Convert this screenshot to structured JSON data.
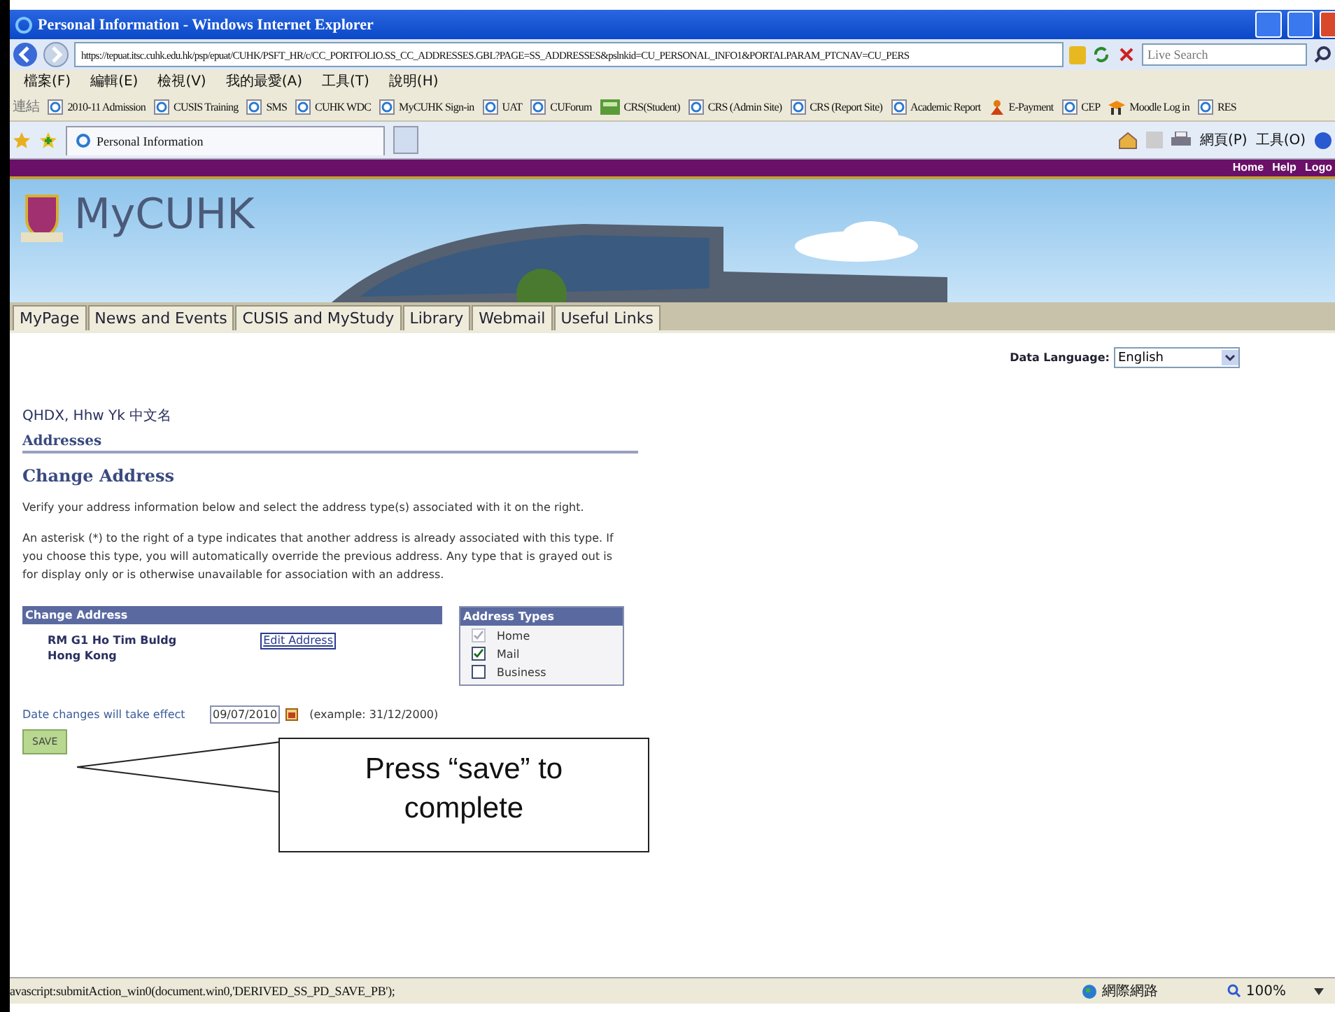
{
  "window": {
    "title": "Personal Information - Windows Internet Explorer"
  },
  "address_bar": {
    "url": "https://tepuat.itsc.cuhk.edu.hk/psp/epuat/CUHK/PSFT_HR/c/CC_PORTFOLIO.SS_CC_ADDRESSES.GBL?PAGE=SS_ADDRESSES&pslnkid=CU_PERSONAL_INFO1&PORTALPARAM_PTCNAV=CU_PERS"
  },
  "search": {
    "placeholder": "Live Search"
  },
  "menu_bar": [
    "檔案(F)",
    "編輯(E)",
    "檢視(V)",
    "我的最愛(A)",
    "工具(T)",
    "說明(H)"
  ],
  "links_bar": {
    "label": "連結",
    "items": [
      {
        "label": "2010-11 Admission",
        "kind": "page"
      },
      {
        "label": "CUSIS Training",
        "kind": "page"
      },
      {
        "label": "SMS",
        "kind": "page"
      },
      {
        "label": "CUHK WDC",
        "kind": "page"
      },
      {
        "label": "MyCUHK Sign-in",
        "kind": "page"
      },
      {
        "label": "UAT",
        "kind": "page"
      },
      {
        "label": "CUForum",
        "kind": "page"
      },
      {
        "label": "CRS(Student)",
        "kind": "app"
      },
      {
        "label": "CRS (Admin Site)",
        "kind": "page"
      },
      {
        "label": "CRS (Report Site)",
        "kind": "page"
      },
      {
        "label": "Academic Report",
        "kind": "page"
      },
      {
        "label": "E-Payment",
        "kind": "person"
      },
      {
        "label": "CEP",
        "kind": "page"
      },
      {
        "label": "Moodle Log in",
        "kind": "moodle"
      },
      {
        "label": "RES",
        "kind": "page"
      }
    ]
  },
  "browser_tab": {
    "title": "Personal Information"
  },
  "command_bar": [
    "網頁(P)",
    "工具(O)"
  ],
  "portal_links": [
    "Home",
    "Help",
    "Logo"
  ],
  "logo": "MyCUHK",
  "nav_tabs": [
    "MyPage",
    "News and Events",
    "CUSIS and MyStudy",
    "Library",
    "Webmail",
    "Useful Links"
  ],
  "data_language": {
    "label": "Data Language:",
    "value": "English"
  },
  "person_name": "QHDX, Hhw Yk 中文名",
  "section_title": "Addresses",
  "page_title": "Change Address",
  "instructions": [
    "Verify your address information below and select the address type(s) associated with it on the right.",
    "An asterisk (*) to the right of a type indicates that another address is already associated with this type. If you choose this type, you will automatically override the previous address. Any type that is grayed out is for display only or is otherwise unavailable for association with an address."
  ],
  "address_panel": {
    "title": "Change Address",
    "lines": [
      "RM G1 Ho Tim Buldg",
      "Hong Kong"
    ],
    "edit_link": "Edit Address"
  },
  "address_types": {
    "title": "Address Types",
    "types": [
      {
        "label": "Home",
        "checked": true,
        "disabled": true
      },
      {
        "label": "Mail",
        "checked": true,
        "disabled": false
      },
      {
        "label": "Business",
        "checked": false,
        "disabled": false
      }
    ]
  },
  "effective_date": {
    "label": "Date changes will take effect",
    "value": "09/07/2010",
    "example": "(example: 31/12/2000)"
  },
  "save_button": "SAVE",
  "callout": "Press “save” to complete",
  "status_bar": {
    "text": "avascript:submitAction_win0(document.win0,'DERIVED_SS_PD_SAVE_PB');",
    "zone": "網際網路",
    "zoom": "100%"
  }
}
